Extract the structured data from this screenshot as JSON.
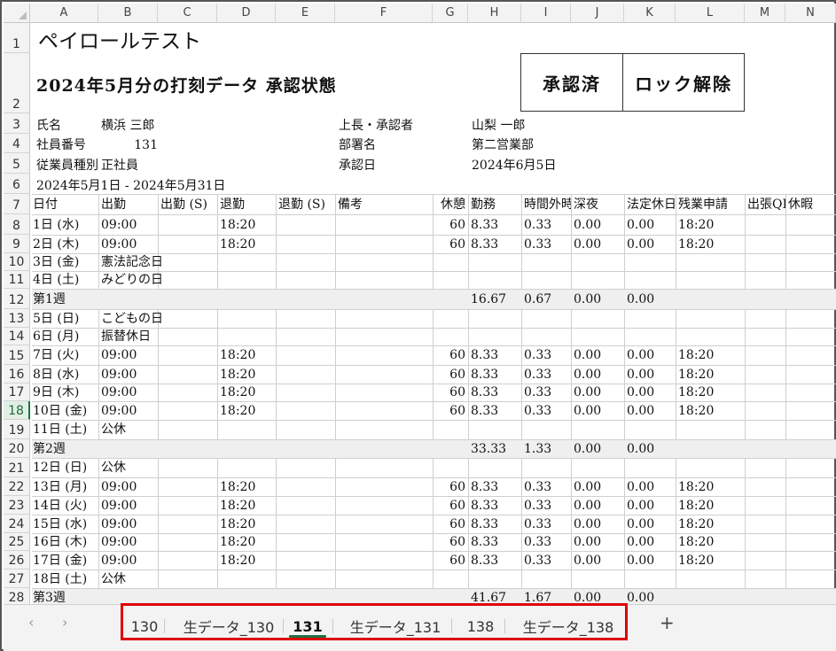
{
  "columns": [
    "A",
    "B",
    "C",
    "D",
    "E",
    "F",
    "G",
    "H",
    "I",
    "J",
    "K",
    "L",
    "M",
    "N"
  ],
  "rows": [
    "1",
    "2",
    "3",
    "4",
    "5",
    "6",
    "7",
    "8",
    "9",
    "10",
    "11",
    "12",
    "13",
    "14",
    "15",
    "16",
    "17",
    "18",
    "19",
    "20",
    "21",
    "22",
    "23",
    "24",
    "25",
    "26",
    "27",
    "28"
  ],
  "active_row": "18",
  "title": "ペイロールテスト",
  "subtitle": "2024年5月分の打刻データ  承認状態",
  "status_approved": "承認済",
  "unlock_button": "ロック解除",
  "info": {
    "name_label": "氏名",
    "name_value": "横浜 三郎",
    "empno_label": "社員番号",
    "empno_value": "131",
    "emptype_label": "従業員種別",
    "emptype_value": "正社員",
    "period": "2024年5月1日 - 2024年5月31日",
    "approver_label": "上長・承認者",
    "approver_value": "山梨 一郎",
    "dept_label": "部署名",
    "dept_value": "第二営業部",
    "approvedate_label": "承認日",
    "approvedate_value": "2024年6月5日"
  },
  "table_headers": [
    "日付",
    "出勤",
    "出勤 (S)",
    "退勤",
    "退勤 (S)",
    "備考",
    "休憩",
    "勤務",
    "時間外時間",
    "深夜",
    "法定休日",
    "残業申請",
    "出張QR",
    "休暇"
  ],
  "data_rows": [
    {
      "a": "1日 (水)",
      "b": "09:00",
      "d": "18:20",
      "g": "60",
      "h": "8.33",
      "i": "0.33",
      "j": "0.00",
      "k": "0.00",
      "l": "18:20"
    },
    {
      "a": "2日 (木)",
      "b": "09:00",
      "d": "18:20",
      "g": "60",
      "h": "8.33",
      "i": "0.33",
      "j": "0.00",
      "k": "0.00",
      "l": "18:20"
    },
    {
      "a": "3日 (金)",
      "b": "憲法記念日"
    },
    {
      "a": "4日 (土)",
      "b": "みどりの日"
    },
    {
      "a": "第1週",
      "h": "16.67",
      "i": "0.67",
      "j": "0.00",
      "k": "0.00",
      "week": true
    },
    {
      "a": "5日 (日)",
      "b": "こどもの日"
    },
    {
      "a": "6日 (月)",
      "b": "振替休日"
    },
    {
      "a": "7日 (火)",
      "b": "09:00",
      "d": "18:20",
      "g": "60",
      "h": "8.33",
      "i": "0.33",
      "j": "0.00",
      "k": "0.00",
      "l": "18:20"
    },
    {
      "a": "8日 (水)",
      "b": "09:00",
      "d": "18:20",
      "g": "60",
      "h": "8.33",
      "i": "0.33",
      "j": "0.00",
      "k": "0.00",
      "l": "18:20"
    },
    {
      "a": "9日 (木)",
      "b": "09:00",
      "d": "18:20",
      "g": "60",
      "h": "8.33",
      "i": "0.33",
      "j": "0.00",
      "k": "0.00",
      "l": "18:20"
    },
    {
      "a": "10日 (金)",
      "b": "09:00",
      "d": "18:20",
      "g": "60",
      "h": "8.33",
      "i": "0.33",
      "j": "0.00",
      "k": "0.00",
      "l": "18:20"
    },
    {
      "a": "11日 (土)",
      "b": "公休"
    },
    {
      "a": "第2週",
      "h": "33.33",
      "i": "1.33",
      "j": "0.00",
      "k": "0.00",
      "week": true
    },
    {
      "a": "12日 (日)",
      "b": "公休"
    },
    {
      "a": "13日 (月)",
      "b": "09:00",
      "d": "18:20",
      "g": "60",
      "h": "8.33",
      "i": "0.33",
      "j": "0.00",
      "k": "0.00",
      "l": "18:20"
    },
    {
      "a": "14日 (火)",
      "b": "09:00",
      "d": "18:20",
      "g": "60",
      "h": "8.33",
      "i": "0.33",
      "j": "0.00",
      "k": "0.00",
      "l": "18:20"
    },
    {
      "a": "15日 (水)",
      "b": "09:00",
      "d": "18:20",
      "g": "60",
      "h": "8.33",
      "i": "0.33",
      "j": "0.00",
      "k": "0.00",
      "l": "18:20"
    },
    {
      "a": "16日 (木)",
      "b": "09:00",
      "d": "18:20",
      "g": "60",
      "h": "8.33",
      "i": "0.33",
      "j": "0.00",
      "k": "0.00",
      "l": "18:20"
    },
    {
      "a": "17日 (金)",
      "b": "09:00",
      "d": "18:20",
      "g": "60",
      "h": "8.33",
      "i": "0.33",
      "j": "0.00",
      "k": "0.00",
      "l": "18:20"
    },
    {
      "a": "18日 (土)",
      "b": "公休"
    },
    {
      "a": "第3週",
      "h": "41.67",
      "i": "1.67",
      "j": "0.00",
      "k": "0.00",
      "week": true
    }
  ],
  "sheet_tabs": [
    "130",
    "生データ_130",
    "131",
    "生データ_131",
    "138",
    "生データ_138"
  ],
  "active_tab": "131",
  "nav_prev": "‹",
  "nav_next": "›",
  "add_sheet": "+"
}
